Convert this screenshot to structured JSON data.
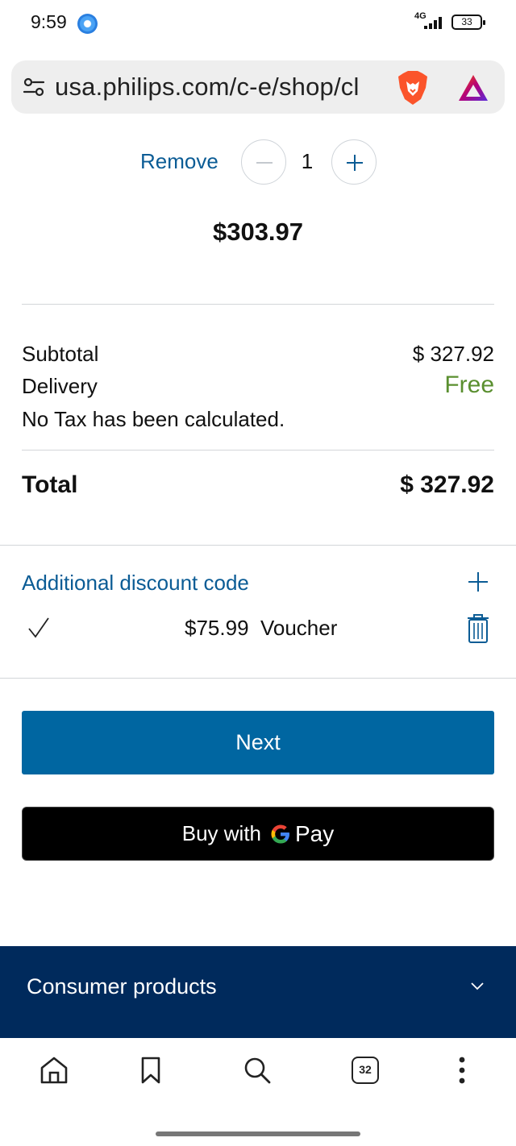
{
  "status_bar": {
    "time": "9:59",
    "network": "4G",
    "battery": "33"
  },
  "browser": {
    "url": "usa.philips.com/c-e/shop/cl",
    "icons": [
      "tune-icon",
      "brave-lion-icon",
      "brave-rewards-icon"
    ]
  },
  "cart_item": {
    "remove_label": "Remove",
    "quantity": "1",
    "price": "$303.97"
  },
  "summary": {
    "subtotal_label": "Subtotal",
    "subtotal_value": "$ 327.92",
    "delivery_label": "Delivery",
    "delivery_value": "Free",
    "tax_note": "No Tax has been calculated.",
    "total_label": "Total",
    "total_value": "$ 327.92"
  },
  "discount": {
    "title": "Additional discount code",
    "voucher_text": "$75.99  Voucher"
  },
  "actions": {
    "next_label": "Next",
    "gpay_label": "Buy with",
    "gpay_pay": "Pay"
  },
  "footer": {
    "title": "Consumer products"
  },
  "bottom_nav": {
    "tabs_count": "32",
    "icons": [
      "home-icon",
      "bookmark-icon",
      "search-icon",
      "tabs-icon",
      "more-vertical-icon"
    ]
  },
  "colors": {
    "link_blue": "#0b5c95",
    "primary_button": "#0066a1",
    "free_green": "#5a8f2f",
    "footer_navy": "#002a5c"
  }
}
